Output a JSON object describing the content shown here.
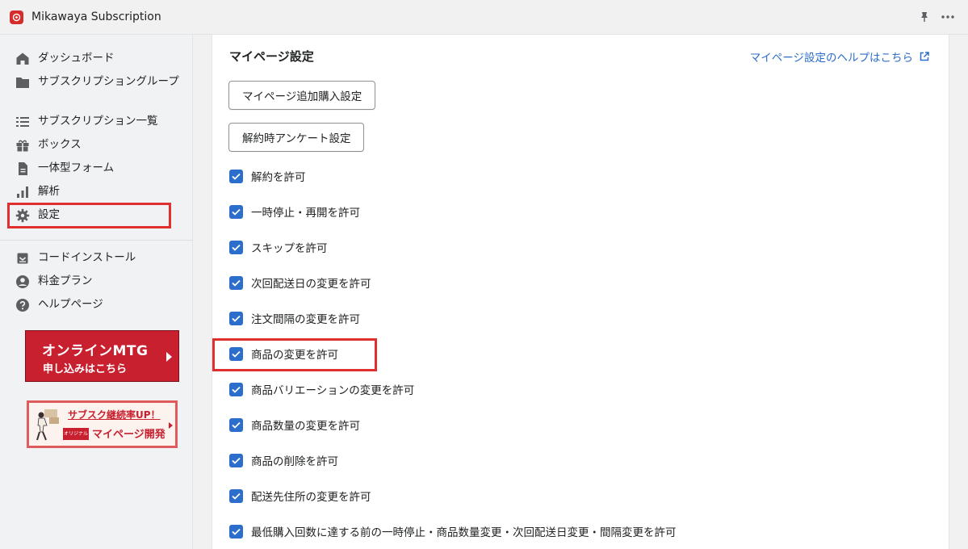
{
  "app": {
    "title": "Mikawaya Subscription",
    "accent_color": "#d72c2c"
  },
  "topbar": {
    "pin_icon": "pin-icon",
    "more_icon": "more-horizontal-icon"
  },
  "sidebar": {
    "items": [
      {
        "label": "ダッシュボード",
        "icon": "home-icon"
      },
      {
        "label": "サブスクリプショングループ",
        "icon": "folder-icon"
      },
      {
        "label": "サブスクリプション一覧",
        "icon": "list-icon"
      },
      {
        "label": "ボックス",
        "icon": "gift-icon"
      },
      {
        "label": "一体型フォーム",
        "icon": "document-icon"
      },
      {
        "label": "解析",
        "icon": "analytics-icon"
      },
      {
        "label": "設定",
        "icon": "gear-icon",
        "highlighted": true
      }
    ],
    "secondary_items": [
      {
        "label": "コードインストール",
        "icon": "install-icon"
      },
      {
        "label": "料金プラン",
        "icon": "user-circle-icon"
      },
      {
        "label": "ヘルプページ",
        "icon": "question-icon"
      }
    ],
    "banner_mtg": {
      "line1": "オンラインMTG",
      "line2": "申し込みはこちら"
    },
    "banner_mypage": {
      "line1": "サブスク継続率UP！",
      "badge": "オリジナル",
      "line2": "マイページ開発"
    },
    "highlight_color": "#e02f2f"
  },
  "main": {
    "title": "マイページ設定",
    "help_link": "マイページ設定のヘルプはこちら",
    "buttons": [
      {
        "label": "マイページ追加購入設定"
      },
      {
        "label": "解約時アンケート設定"
      }
    ],
    "checkboxes": [
      {
        "label": "解約を許可",
        "checked": true
      },
      {
        "label": "一時停止・再開を許可",
        "checked": true
      },
      {
        "label": "スキップを許可",
        "checked": true
      },
      {
        "label": "次回配送日の変更を許可",
        "checked": true
      },
      {
        "label": "注文間隔の変更を許可",
        "checked": true
      },
      {
        "label": "商品の変更を許可",
        "checked": true,
        "highlighted": true
      },
      {
        "label": "商品バリエーションの変更を許可",
        "checked": true
      },
      {
        "label": "商品数量の変更を許可",
        "checked": true
      },
      {
        "label": "商品の削除を許可",
        "checked": true
      },
      {
        "label": "配送先住所の変更を許可",
        "checked": true
      },
      {
        "label": "最低購入回数に達する前の一時停止・商品数量変更・次回配送日変更・間隔変更を許可",
        "checked": true
      }
    ],
    "checkbox_color": "#2c6ecb",
    "link_color": "#2c6ecb"
  }
}
